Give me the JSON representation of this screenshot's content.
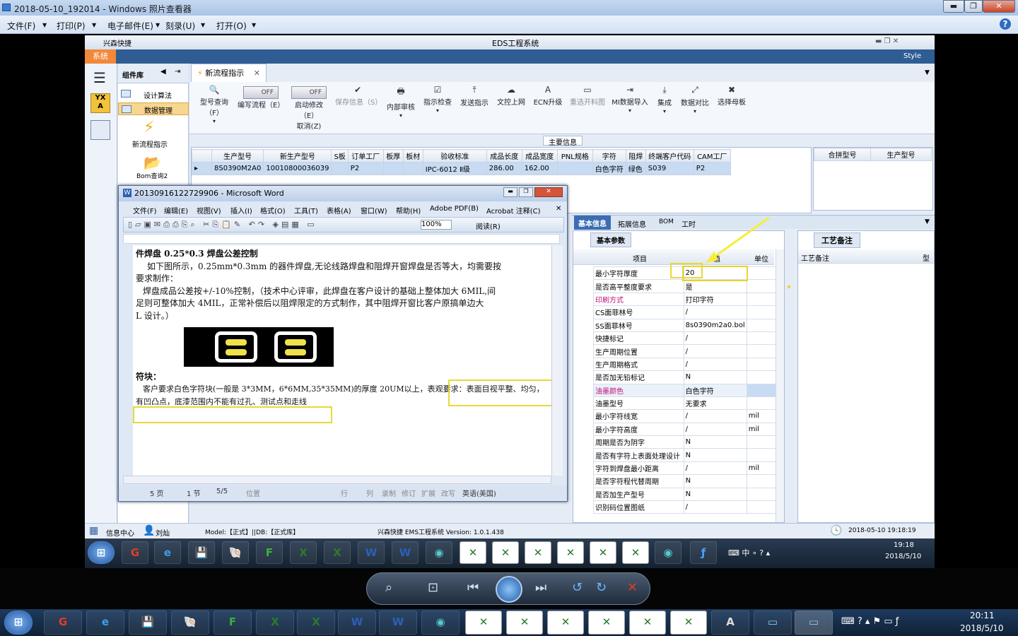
{
  "viewer": {
    "title": "2018-05-10_192014 - Windows 照片查看器",
    "menu": [
      "文件(F)",
      "打印(P)",
      "电子邮件(E)",
      "刻录(U)",
      "打开(O)"
    ],
    "help": "?",
    "min": "▬",
    "restore": "❐",
    "close": "✕"
  },
  "eds": {
    "title": "EDS工程系统",
    "sys_tab": "系统",
    "style_label": "Style",
    "left_win_label": "兴森快捷",
    "component_panel": {
      "title": "组件库",
      "items": [
        "设计算法",
        "数据管理"
      ],
      "big_items": [
        "新流程指示",
        "Bom查询2"
      ]
    },
    "doc_tab": "新流程指示",
    "toolbar": [
      {
        "label": "型号查询（F）",
        "icon": "🔍"
      },
      {
        "label": "编写流程（E）",
        "toggle": "OFF"
      },
      {
        "label": "启动修改（E）",
        "sub": "取消(Z)",
        "toggle": "OFF"
      },
      {
        "label": "保存信息（S）",
        "icon": "✔",
        "disabled": true
      },
      {
        "label": "内部审核",
        "icon": "🖶"
      },
      {
        "label": "指示检查",
        "icon": "☑"
      },
      {
        "label": "发送指示",
        "icon": "⤒"
      },
      {
        "label": "文控上网",
        "icon": "☁"
      },
      {
        "label": "ECN升级",
        "icon": "A"
      },
      {
        "label": "重选开料图",
        "icon": "▭",
        "disabled": true
      },
      {
        "label": "MI数据导入",
        "icon": "⇥"
      },
      {
        "label": "集成",
        "icon": "⤓"
      },
      {
        "label": "数据对比",
        "icon": "⤢"
      },
      {
        "label": "选择母板",
        "icon": "✖"
      }
    ],
    "main_info_label": "主要信息",
    "grid_headers": [
      "生产型号",
      "新生产型号",
      "S板",
      "订单工厂",
      "板厚",
      "板材",
      "验收标准",
      "成品长度",
      "成品宽度",
      "PNL规格",
      "字符",
      "阻焊",
      "终端客户代码",
      "CAM工厂"
    ],
    "grid_row": [
      "8S0390M2A0",
      "10010800036039",
      "",
      "P2",
      "",
      "",
      "IPC-6012 Ⅱ级",
      "286.00",
      "162.00",
      "",
      "白色字符",
      "绿色",
      "S039",
      "P2"
    ],
    "right_grid_headers": [
      "合拼型号",
      "生产型号"
    ],
    "detail_tabs": [
      "基本信息",
      "拓展信息",
      "BOM",
      "工时"
    ],
    "basic_params_tab": "基本参数",
    "prop_headers": [
      "项目",
      "值",
      "单位"
    ],
    "props": [
      [
        "最小字符厚度",
        "20",
        ""
      ],
      [
        "是否高平整度要求",
        "是",
        ""
      ],
      [
        "印刷方式",
        "打印字符",
        ""
      ],
      [
        "CS面菲林号",
        "/",
        ""
      ],
      [
        "SS面菲林号",
        "8s0390m2a0.bol",
        ""
      ],
      [
        "快捷标记",
        "/",
        ""
      ],
      [
        "生产周期位置",
        "/",
        ""
      ],
      [
        "生产周期格式",
        "/",
        ""
      ],
      [
        "是否加无铅标记",
        "N",
        ""
      ],
      [
        "油墨颜色",
        "白色字符",
        ""
      ],
      [
        "油墨型号",
        "无要求",
        ""
      ],
      [
        "最小字符线宽",
        "/",
        "mil"
      ],
      [
        "最小字符高度",
        "/",
        "mil"
      ],
      [
        "周期是否为阴字",
        "N",
        ""
      ],
      [
        "是否有字符上表面处理设计",
        "N",
        ""
      ],
      [
        "字符到焊盘最小距离",
        "/",
        "mil"
      ],
      [
        "是否字符程代替周期",
        "N",
        ""
      ],
      [
        "是否加生产型号",
        "N",
        ""
      ],
      [
        "识别码位置图纸",
        "/",
        ""
      ]
    ],
    "process_notes_tab": "工艺备注",
    "process_notes_header": "工艺备注",
    "process_notes_col2": "型",
    "status": {
      "info_center": "信息中心",
      "user": "刘灿",
      "model": "Model:【正式】||DB:【正式库】",
      "app": "兴森快捷 EMS工程系统 Version: 1.0.1.438",
      "datetime": "2018-05-10 19:18:19"
    },
    "inner_clock": {
      "time": "19:18",
      "date": "2018/5/10"
    }
  },
  "word": {
    "title": "20130916122729906 - Microsoft Word",
    "menu": [
      "文件(F)",
      "编辑(E)",
      "视图(V)",
      "插入(I)",
      "格式(O)",
      "工具(T)",
      "表格(A)",
      "窗口(W)",
      "帮助(H)",
      "Adobe PDF(B)",
      "Acrobat 注释(C)"
    ],
    "zoom": "100%",
    "read": "阅读(R)",
    "doc": {
      "heading": "件焊盘 0.25*0.3 焊盘公差控制",
      "p1": "如下图所示，0.25mm*0.3mm 的器件焊盘,无论线路焊盘和阻焊开窗焊盘是否等大，均需要按",
      "p1b": "要求制作：",
      "p2": "焊盘成品公差按+/-10%控制，（技术中心评审，此焊盘在客户设计的基础上整体加大 6MIL,间",
      "p2b": "足则可整体加大 4MIL，正常补偿后以阻焊限定的方式制作，其中阻焊开窗比客户原搞单边大",
      "p2c": "L 设计。）",
      "h2": "符块：",
      "p3": "客户要求白色字符块(一般是 3*3MM，6*6MM,35*35MM)的厚度 20UM以上，表观要求：表面目视平整、均匀，",
      "p4": "有凹凸点，底漆范围内不能有过孔、测试点和走线"
    },
    "status": [
      "5 页",
      "1 节",
      "5/5",
      "位置",
      "行",
      "列",
      "录制",
      "修订",
      "扩展",
      "改写",
      "英语(美国)"
    ]
  },
  "viewer_controls": [
    "zoom-icon",
    "actual-size-icon",
    "previous-icon",
    "slideshow-icon",
    "next-icon",
    "rotate-ccw-icon",
    "rotate-cw-icon",
    "delete-icon"
  ],
  "clock": {
    "time": "20:11",
    "date": "2018/5/10"
  }
}
